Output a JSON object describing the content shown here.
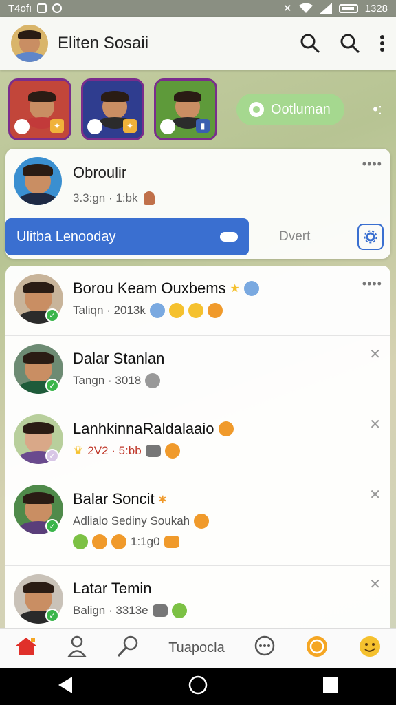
{
  "status_bar": {
    "carrier": "T4ofı",
    "time": "1328"
  },
  "header": {
    "title": "Eliten Sosaii"
  },
  "stories": {
    "action_label": "Ootluman",
    "items": [
      {
        "bg": "#c2463a",
        "shirt": "#c23a3a"
      },
      {
        "bg": "#2f3d8f",
        "shirt": "#2b2b2b"
      },
      {
        "bg": "#5e9a3a",
        "shirt": "#2b2b2b"
      }
    ]
  },
  "featured": {
    "name": "Obroulir",
    "subtitle": "3.3:gn · 1:bk",
    "primary_button": "Ulitba Lenooday",
    "secondary_link": "Dvert"
  },
  "chats": [
    {
      "name": "Borou Keam Ouxbems",
      "preview": "Taliqn · 2013k",
      "shirt": "#2b2b2b",
      "bg": "#c8b49a"
    },
    {
      "name": "Dalar Stanlan",
      "preview": "Tangn · 3018",
      "shirt": "#1e5b3a",
      "bg": "#6d8b73"
    },
    {
      "name": "LanhkinnaRaldalaaio",
      "preview": "2V2 · 5:bb",
      "shirt": "#6a4a8e",
      "bg": "#b8cf9c"
    },
    {
      "name": "Balar Soncit",
      "preview": "Adlialo Sediny Soukah",
      "preview2": "1:1g0",
      "shirt": "#5a3e7a",
      "bg": "#4f8a4a"
    },
    {
      "name": "Latar Temin",
      "preview": "Balign · 3313e",
      "shirt": "#2a2a2a",
      "bg": "#c9c2b8"
    }
  ],
  "bottom_nav": {
    "center_label": "Tuapocla"
  },
  "colors": {
    "accent": "#3a6fd0",
    "online": "#3ab54a",
    "pill": "#a5d88f"
  }
}
